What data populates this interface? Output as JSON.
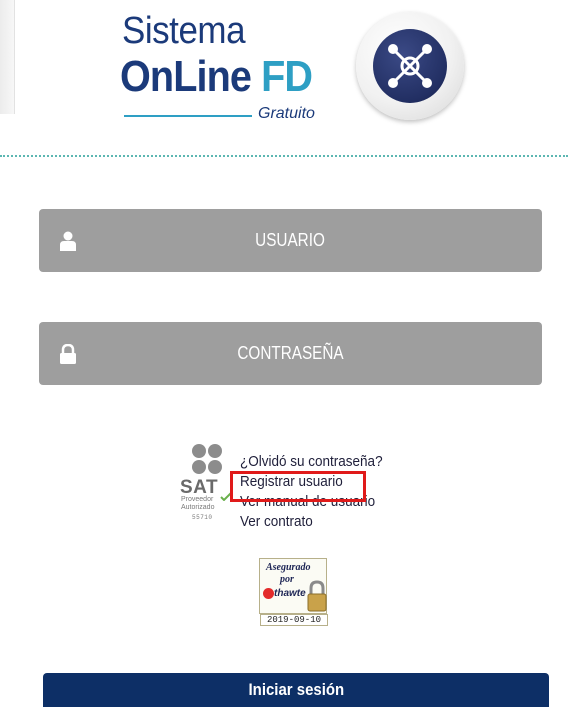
{
  "logo": {
    "line1": "Sistema",
    "line2_a": "OnLine",
    "line2_b": "FD",
    "subtitle": "Gratuito",
    "icon": "network-hub-icon",
    "colors": {
      "primary": "#1b3a7a",
      "accent": "#2e9fc4"
    }
  },
  "form": {
    "username": {
      "placeholder": "USUARIO",
      "icon": "user-icon"
    },
    "password": {
      "placeholder": "CONTRASEÑA",
      "icon": "lock-icon"
    },
    "field_color": "#9e9e9e"
  },
  "links": {
    "forgot": "¿Olvidó su contraseña?",
    "register": "Registrar usuario",
    "manual": "Ver manual de usuario",
    "contract": "Ver contrato"
  },
  "sat_badge": {
    "word": "SAT",
    "line1": "Proveedor",
    "line2": "Autorizado",
    "number": "55710"
  },
  "seal": {
    "line1": "Asegurado",
    "line2": "por",
    "brand": "thawte",
    "date": "2019-09-10"
  },
  "login_button": {
    "label": "Iniciar sesión",
    "color": "#0d2f66"
  },
  "highlight_color": "#e01a1a"
}
